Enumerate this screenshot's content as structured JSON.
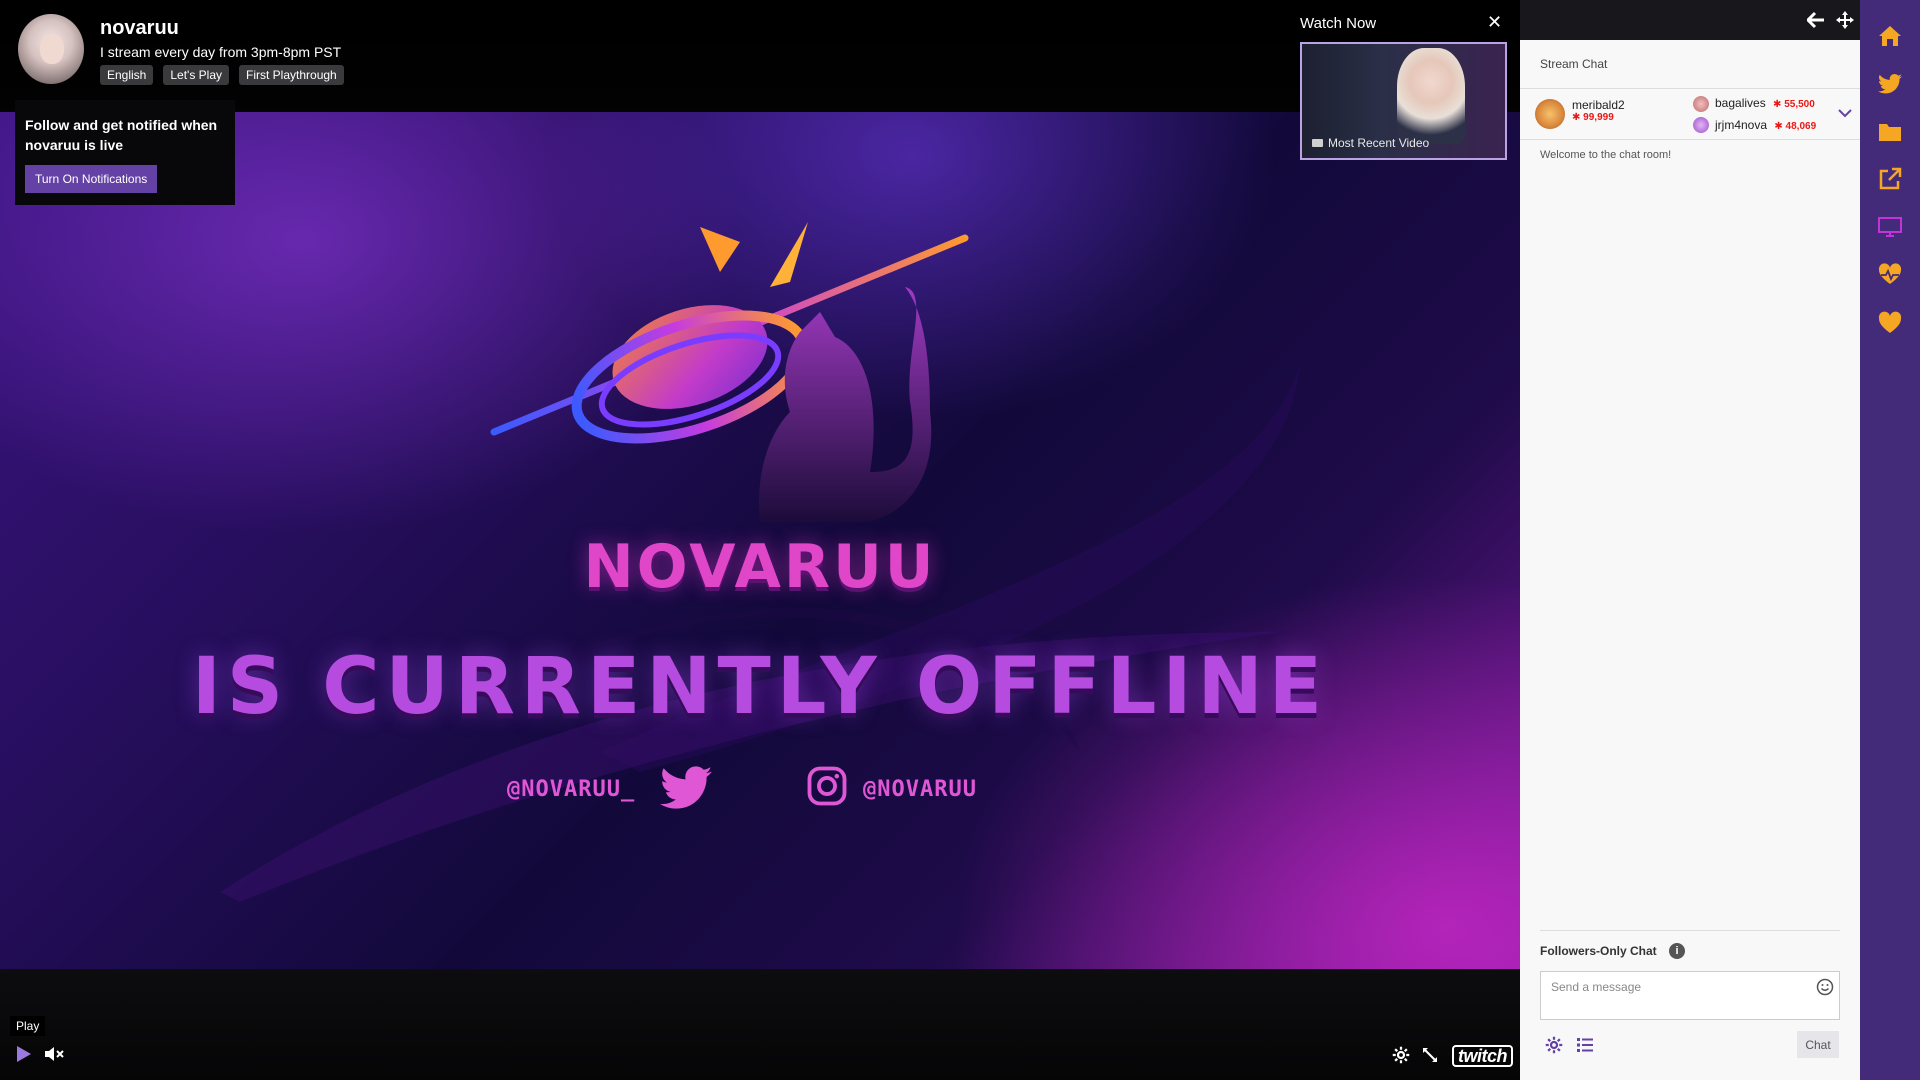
{
  "channel": {
    "name": "novaruu",
    "description": "I stream every day from 3pm-8pm PST",
    "tags": [
      "English",
      "Let's Play",
      "First Playthrough"
    ]
  },
  "follow_prompt": {
    "text": "Follow and get notified when novaruu is live",
    "button_label": "Turn On Notifications"
  },
  "watch_now": {
    "title": "Watch Now",
    "close_glyph": "✕",
    "thumbnail_label": "Most Recent Video"
  },
  "banner": {
    "name": "NOVARUU",
    "status": "IS CURRENTLY OFFLINE",
    "twitter_handle": "@NOVARUU_",
    "instagram_handle": "@NOVARUU"
  },
  "player_controls": {
    "tooltip": "Play",
    "play_icon": "play-icon",
    "mute_icon": "mute-icon",
    "settings_icon": "gear-icon",
    "fullscreen_icon": "expand-icon",
    "logo_text": "twitch"
  },
  "chat": {
    "title": "Stream Chat",
    "top_chatters": [
      {
        "name": "meribald2",
        "points": "99,999"
      },
      {
        "name": "bagalives",
        "points": "55,500"
      },
      {
        "name": "jrjm4nova",
        "points": "48,069"
      }
    ],
    "welcome": "Welcome to the chat room!",
    "mode_label": "Followers-Only Chat",
    "input_placeholder": "Send a message",
    "send_label": "Chat"
  },
  "rail_icons": [
    "home-icon",
    "twitter-icon",
    "folder-icon",
    "external-link-icon",
    "monitor-icon",
    "heart-pulse-icon",
    "heart-icon"
  ],
  "colors": {
    "accent": "#6441a4",
    "rail_bg": "#432b7a",
    "rail_icon": "#f5a623",
    "rail_active": "#c233d8",
    "points_red": "#e91916"
  }
}
